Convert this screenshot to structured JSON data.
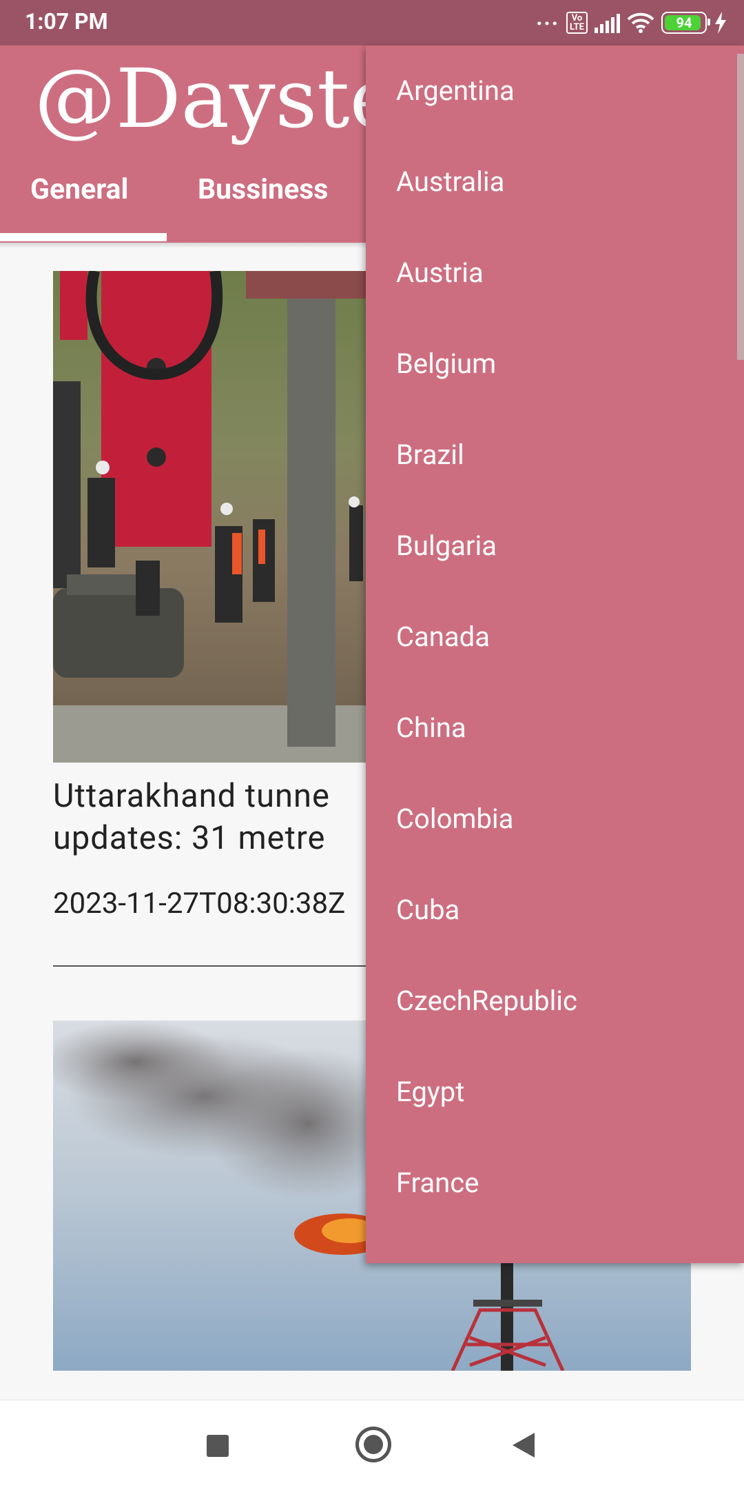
{
  "status_bar": {
    "time": "1:07 PM",
    "dots": "...",
    "volte": "Vo\nLTE",
    "battery": "94"
  },
  "app": {
    "title": "@Dayste",
    "tabs": [
      {
        "label": "General"
      },
      {
        "label": "Bussiness"
      }
    ],
    "colors": {
      "primary": "#cd6e80",
      "status": "#9b5466"
    }
  },
  "article": {
    "headline_line1": "Uttarakhand tunne",
    "headline_line2": "updates: 31 metre",
    "published": "2023-11-27T08:30:38Z"
  },
  "country_menu": {
    "items": [
      "Argentina",
      "Australia",
      "Austria",
      "Belgium",
      "Brazil",
      "Bulgaria",
      "Canada",
      "China",
      "Colombia",
      "Cuba",
      "CzechRepublic",
      "Egypt",
      "France"
    ]
  }
}
